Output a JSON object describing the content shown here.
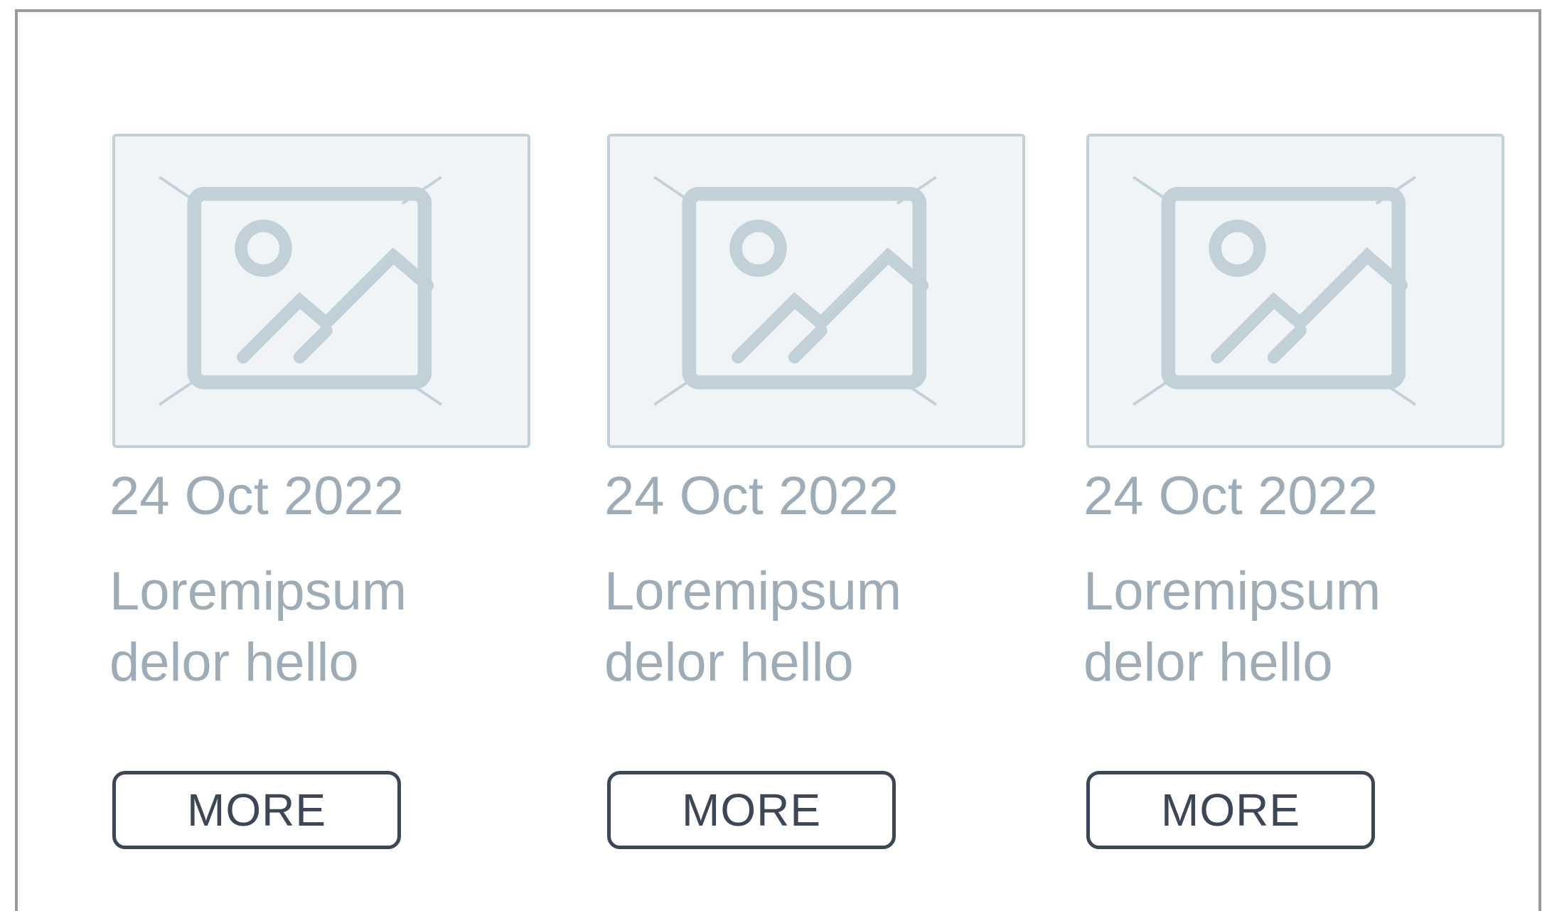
{
  "cards": [
    {
      "date": "24 Oct 2022",
      "title": "Loremipsum delor hello",
      "button_label": "MORE",
      "image_icon": "image-placeholder-icon"
    },
    {
      "date": "24 Oct 2022",
      "title": "Loremipsum delor hello",
      "button_label": "MORE",
      "image_icon": "image-placeholder-icon"
    },
    {
      "date": "24 Oct 2022",
      "title": "Loremipsum delor hello",
      "button_label": "MORE",
      "image_icon": "image-placeholder-icon"
    }
  ],
  "colors": {
    "frame_border": "#9a9a9a",
    "placeholder_stroke": "#c2d0d8",
    "placeholder_fill": "#f0f4f7",
    "text_muted": "#9eacb7",
    "button_dark": "#3d4656"
  }
}
